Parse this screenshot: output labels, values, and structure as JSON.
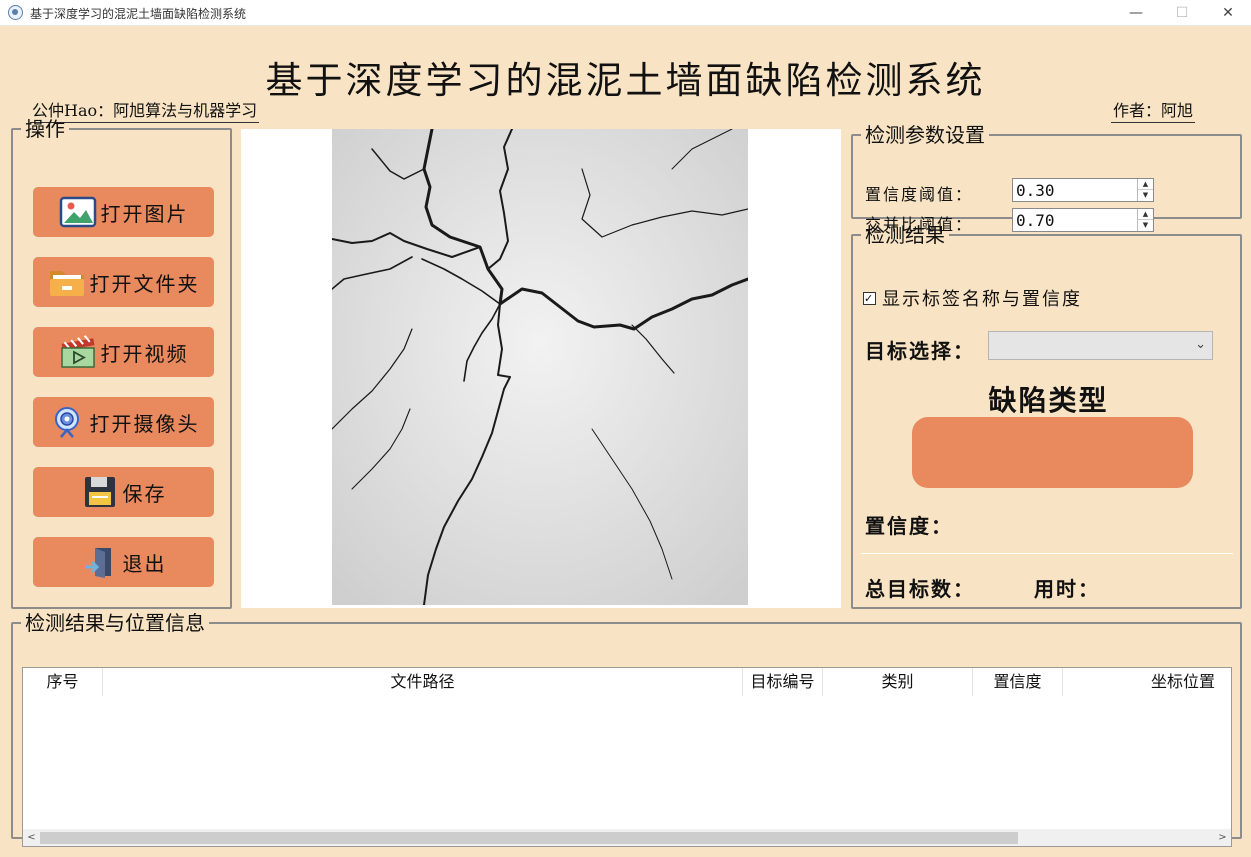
{
  "window": {
    "title": "基于深度学习的混泥土墙面缺陷检测系统",
    "min_glyph": "—",
    "max_glyph": "☐",
    "close_glyph": "✕"
  },
  "header": {
    "title": "基于深度学习的混泥土墙面缺陷检测系统",
    "left_note": "公仲Hao：阿旭算法与机器学习",
    "right_note": "作者：阿旭"
  },
  "ops": {
    "legend": "操作",
    "buttons": [
      {
        "label": "打开图片",
        "icon": "image-icon"
      },
      {
        "label": "打开文件夹",
        "icon": "folder-icon"
      },
      {
        "label": "打开视频",
        "icon": "video-icon"
      },
      {
        "label": "打开摄像头",
        "icon": "webcam-icon"
      },
      {
        "label": "保存",
        "icon": "save-icon"
      },
      {
        "label": "退出",
        "icon": "exit-icon"
      }
    ]
  },
  "params": {
    "legend": "检测参数设置",
    "confidence_label": "置信度阈值：",
    "confidence_value": "0.30",
    "iou_label": "交并比阈值：",
    "iou_value": "0.70",
    "up_glyph": "▲",
    "down_glyph": "▼"
  },
  "results": {
    "legend": "检测结果",
    "show_labels_text": "显示标签名称与置信度",
    "show_labels_checked": true,
    "check_glyph": "✓",
    "target_select_label": "目标选择：",
    "target_select_value": "",
    "chevron_glyph": "⌄",
    "defect_type_title": "缺陷类型",
    "defect_type_value": "",
    "confidence_label": "置信度：",
    "total_label": "总目标数：",
    "time_label": "用时："
  },
  "table": {
    "legend": "检测结果与位置信息",
    "columns": [
      "序号",
      "文件路径",
      "目标编号",
      "类别",
      "置信度",
      "坐标位置"
    ],
    "rows": [],
    "scroll_left_glyph": "<",
    "scroll_right_glyph": ">"
  },
  "colors": {
    "background": "#f8e4c4",
    "button": "#e8895e",
    "accent_panel": "#e8895e"
  }
}
